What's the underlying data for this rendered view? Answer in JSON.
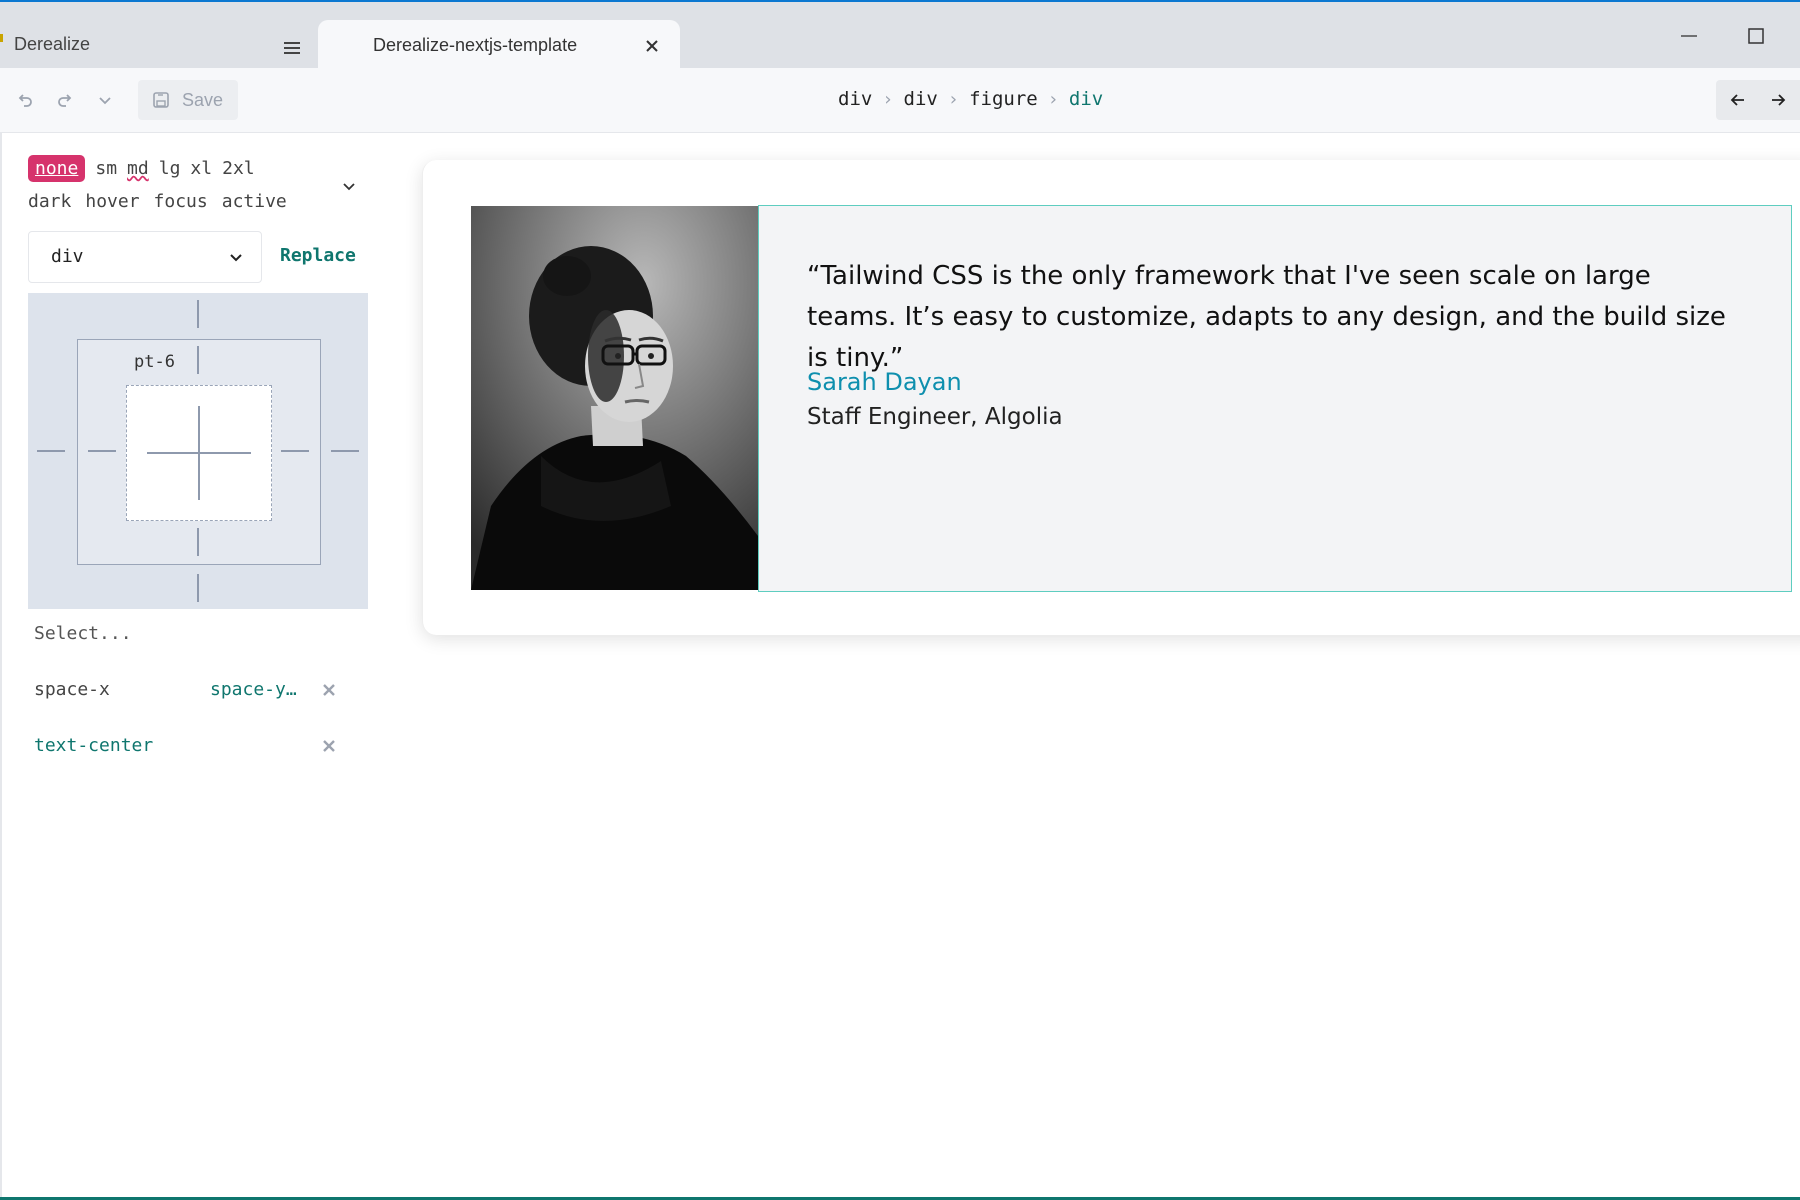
{
  "window": {
    "app_name": "Derealize",
    "tab_title": "Derealize-nextjs-template"
  },
  "toolbar": {
    "save_label": "Save"
  },
  "breadcrumb": [
    "div",
    "div",
    "figure",
    "div"
  ],
  "breakpoints": [
    "none",
    "sm",
    "md",
    "lg",
    "xl",
    "2xl"
  ],
  "states": [
    "dark",
    "hover",
    "focus",
    "active"
  ],
  "tag_select": {
    "value": "div",
    "replace_label": "Replace"
  },
  "box_model": {
    "padding_label": "pt-6"
  },
  "class_select": {
    "placeholder": "Select..."
  },
  "classes": [
    {
      "left": "space-x",
      "right": "space-y…"
    },
    {
      "left": "text-center",
      "right": ""
    }
  ],
  "canvas": {
    "quote": "“Tailwind CSS is the only framework that I've seen scale on large teams. It’s easy to customize, adapts to any design, and the build size is tiny.”",
    "author": "Sarah Dayan",
    "role": "Staff Engineer, Algolia"
  },
  "colors": {
    "accent": "#0f766e",
    "chip": "#d6336c",
    "selection_border": "#5ecdc0",
    "author_link": "#0e8fae"
  }
}
